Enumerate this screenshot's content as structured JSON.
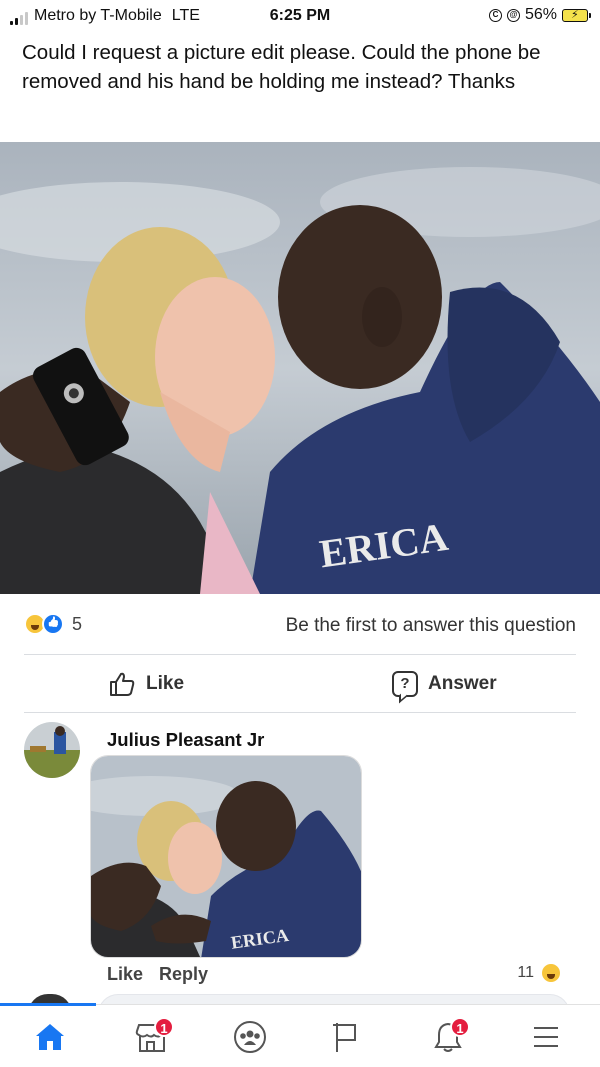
{
  "status_bar": {
    "carrier": "Metro by T-Mobile",
    "network": "LTE",
    "time": "6:25 PM",
    "battery": "56%"
  },
  "post": {
    "text": "Could I request a picture edit please. Could the phone be removed and his hand be holding me instead? Thanks",
    "reaction_count": "5",
    "first_answer_prompt": "Be the first to answer this question",
    "like_label": "Like",
    "answer_label": "Answer"
  },
  "comment": {
    "author": "Julius Pleasant Jr",
    "like_label": "Like",
    "reply_label": "Reply",
    "reaction_count": "11"
  },
  "bottom_nav": {
    "items": [
      {
        "name": "home-icon",
        "badge": ""
      },
      {
        "name": "marketplace-icon",
        "badge": "1"
      },
      {
        "name": "groups-icon",
        "badge": ""
      },
      {
        "name": "pages-flag-icon",
        "badge": ""
      },
      {
        "name": "notifications-bell-icon",
        "badge": "1"
      },
      {
        "name": "menu-icon",
        "badge": ""
      }
    ]
  },
  "colors": {
    "accent": "#1877f2",
    "badge": "#e41e3f",
    "haha": "#f7c53b"
  }
}
